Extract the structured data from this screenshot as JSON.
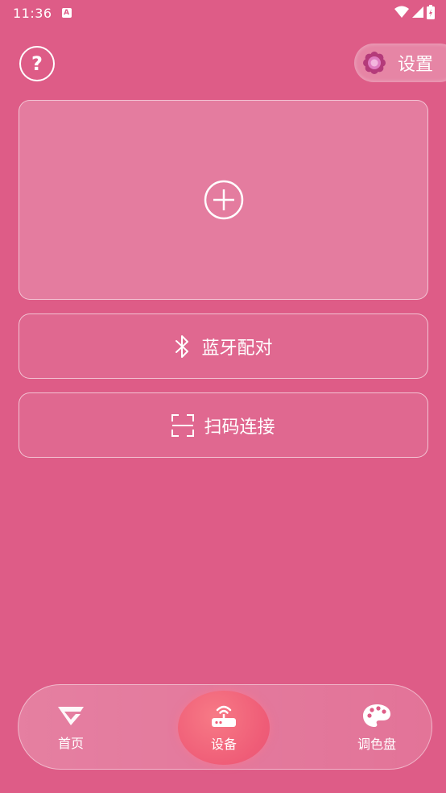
{
  "status_bar": {
    "time": "11:36",
    "notif_letter": "A"
  },
  "header": {
    "help_symbol": "?",
    "settings_label": "设置"
  },
  "add_card": {
    "icon": "plus-circle-icon"
  },
  "actions": {
    "bluetooth_label": "蓝牙配对",
    "scan_label": "扫码连接"
  },
  "nav": {
    "home_label": "首页",
    "device_label": "设备",
    "palette_label": "调色盘",
    "active": "设备"
  },
  "colors": {
    "background": "#de5c87",
    "active_bubble": "#ef5c77",
    "text": "#ffffff"
  }
}
